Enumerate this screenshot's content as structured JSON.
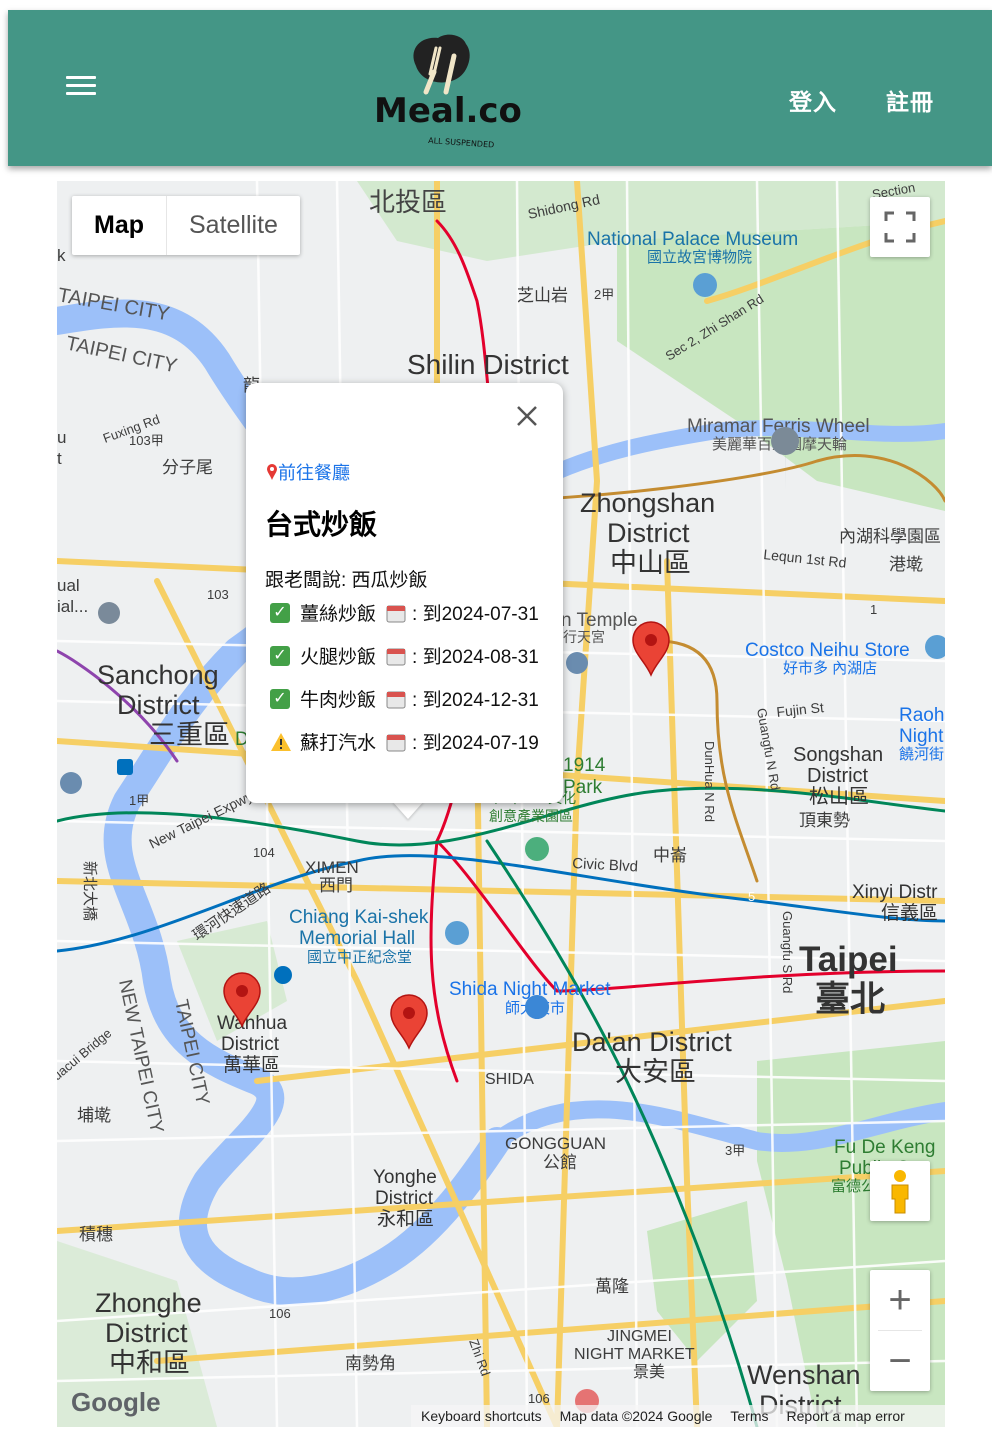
{
  "header": {
    "logo_text": "Meal.co",
    "logo_tagline": "ALL SUSPENDED",
    "login": "登入",
    "register": "註冊"
  },
  "map": {
    "type_controls": {
      "map": "Map",
      "satellite": "Satellite",
      "selected": "Map"
    },
    "attribution": {
      "keyboard": "Keyboard shortcuts",
      "data": "Map data ©2024 Google",
      "terms": "Terms",
      "report": "Report a map error"
    },
    "google_logo": "Google",
    "labels": {
      "beitou": "北投區",
      "shidong": "Shidong Rd",
      "npm_en": "National Palace Museum",
      "npm_zh": "國立故宮博物院",
      "zhishanyan": "芝山岩",
      "section": "Section",
      "zhishan_rd": "Sec 2, Zhi Shan Rd",
      "taipei_city_1": "TAIPEI CITY",
      "taipei_city_2": "TAIPEI CITY",
      "shilin_en": "Shilin District",
      "fuxing": "Fuxing Rd",
      "r103a": "103甲",
      "fenziwei": "分子尾",
      "miramar_en": "Miramar Ferris Wheel",
      "miramar_zh": "美麗華百樂園摩天輪",
      "zhongshan_en1": "Zhongshan",
      "zhongshan_en2": "District",
      "zhongshan_zh": "中山區",
      "neihu_sci": "內湖科學園區",
      "lequn": "Lequn 1st Rd",
      "gangqi": "港墘",
      "r103": "103",
      "temple": "n Temple",
      "temple_zh": "行天宮",
      "costco_en": "Costco Neihu Store",
      "costco_zh": "好市多 內湖店",
      "sanchong_en1": "Sanchong",
      "sanchong_en2": "District",
      "sanchong_zh": "三重區",
      "fujin": "Fujin St",
      "raohe_en1": "Raohe",
      "raohe_en2": "Night",
      "raohe_zh": "饒河街",
      "guangfu_n": "Guangfu N Rd",
      "dunhua_n": "DunHua N Rd",
      "songshan_en1": "Songshan",
      "songshan_en2": "District",
      "songshan_zh": "松山區",
      "dingdongshi": "頂東勢",
      "park_1914": "1914",
      "park_en": "Park",
      "huashan_zh1": "華山1914文化",
      "huashan_zh2": "創意產業園區",
      "civic": "Civic Blvd",
      "zhonglun": "中崙",
      "r1a": "1甲",
      "newtaipei_expwy": "New Taipei Expwy",
      "r104": "104",
      "ximen_en": "XIMEN",
      "ximen_zh": "西門",
      "xinyi_en": "Xinyi Distr",
      "xinyi_zh": "信義區",
      "r5": "5",
      "xinbei_blvd": "新北大橋",
      "huanhe": "環河快速道路",
      "ckm_en1": "Chiang Kai-shek",
      "ckm_en2": "Memorial Hall",
      "ckm_zh": "國立中正紀念堂",
      "guangfu_s": "Guangfu S Rd",
      "taipei_en": "Taipei",
      "taipei_zh": "臺北",
      "shida_en": "Shida Night Market",
      "shida_zh": "師大夜市",
      "newtaipei_city": "NEW TAIPEI CITY",
      "taipei_city_3": "TAIPEI CITY",
      "wanhua_en1": "Wanhua",
      "wanhua_en2": "District",
      "wanhua_zh": "萬華區",
      "daan_en": "Da'an District",
      "daan_zh": "大安區",
      "huacui": "uacui Bridge",
      "puding": "埔墘",
      "shida": "SHIDA",
      "gongguan_en": "GONGGUAN",
      "gongguan_zh": "公館",
      "r3a": "3甲",
      "fudekeng_en1": "Fu De Keng",
      "fudekeng_en2": "Public Ce",
      "fudekeng_zh": "富德公墓",
      "yonghe_en1": "Yonghe",
      "yonghe_en2": "District",
      "yonghe_zh": "永和區",
      "jisui": "積穗",
      "wanlong": "萬隆",
      "zhonghe_en1": "Zhonghe",
      "zhonghe_en2": "District",
      "zhonghe_zh": "中和區",
      "r106a": "106",
      "nanshijiao": "南勢角",
      "jingmei_en1": "JINGMEI",
      "jingmei_en2": "NIGHT MARKET",
      "jingmei_zh": "景美",
      "wenshan_en1": "Wenshan",
      "wenshan_en2": "District",
      "r106b": "106",
      "zhi_rd": "Zhi Rd",
      "r2a": "2甲",
      "r1": "1",
      "ual": "ual",
      "ial": "ial...",
      "u": "u",
      "t": "t",
      "k": "k",
      "d": "D",
      "bei": "龍"
    },
    "markers": [
      {
        "name": "marker-zhongshan"
      },
      {
        "name": "marker-wanhua"
      },
      {
        "name": "marker-zhongzheng"
      }
    ]
  },
  "popup": {
    "link": "前往餐廳",
    "title": "台式炒飯",
    "subtitle": "跟老闆說: 西瓜炒飯",
    "items": [
      {
        "status": "ok",
        "name": "薑絲炒飯",
        "date": ": 到2024-07-31"
      },
      {
        "status": "ok",
        "name": "火腿炒飯",
        "date": ": 到2024-08-31"
      },
      {
        "status": "ok",
        "name": "牛肉炒飯",
        "date": ": 到2024-12-31"
      },
      {
        "status": "warn",
        "name": "蘇打汽水",
        "date": ": 到2024-07-19"
      }
    ]
  },
  "colors": {
    "header": "#449686",
    "link": "#1a73e8",
    "marker": "#ea4335",
    "water": "#9cc0f9",
    "park": "#c8e6c0",
    "road_major": "#f6cf65",
    "metro_red": "#e3002c",
    "metro_blue": "#0070bd",
    "metro_green": "#008659",
    "metro_brown": "#c48c31"
  }
}
